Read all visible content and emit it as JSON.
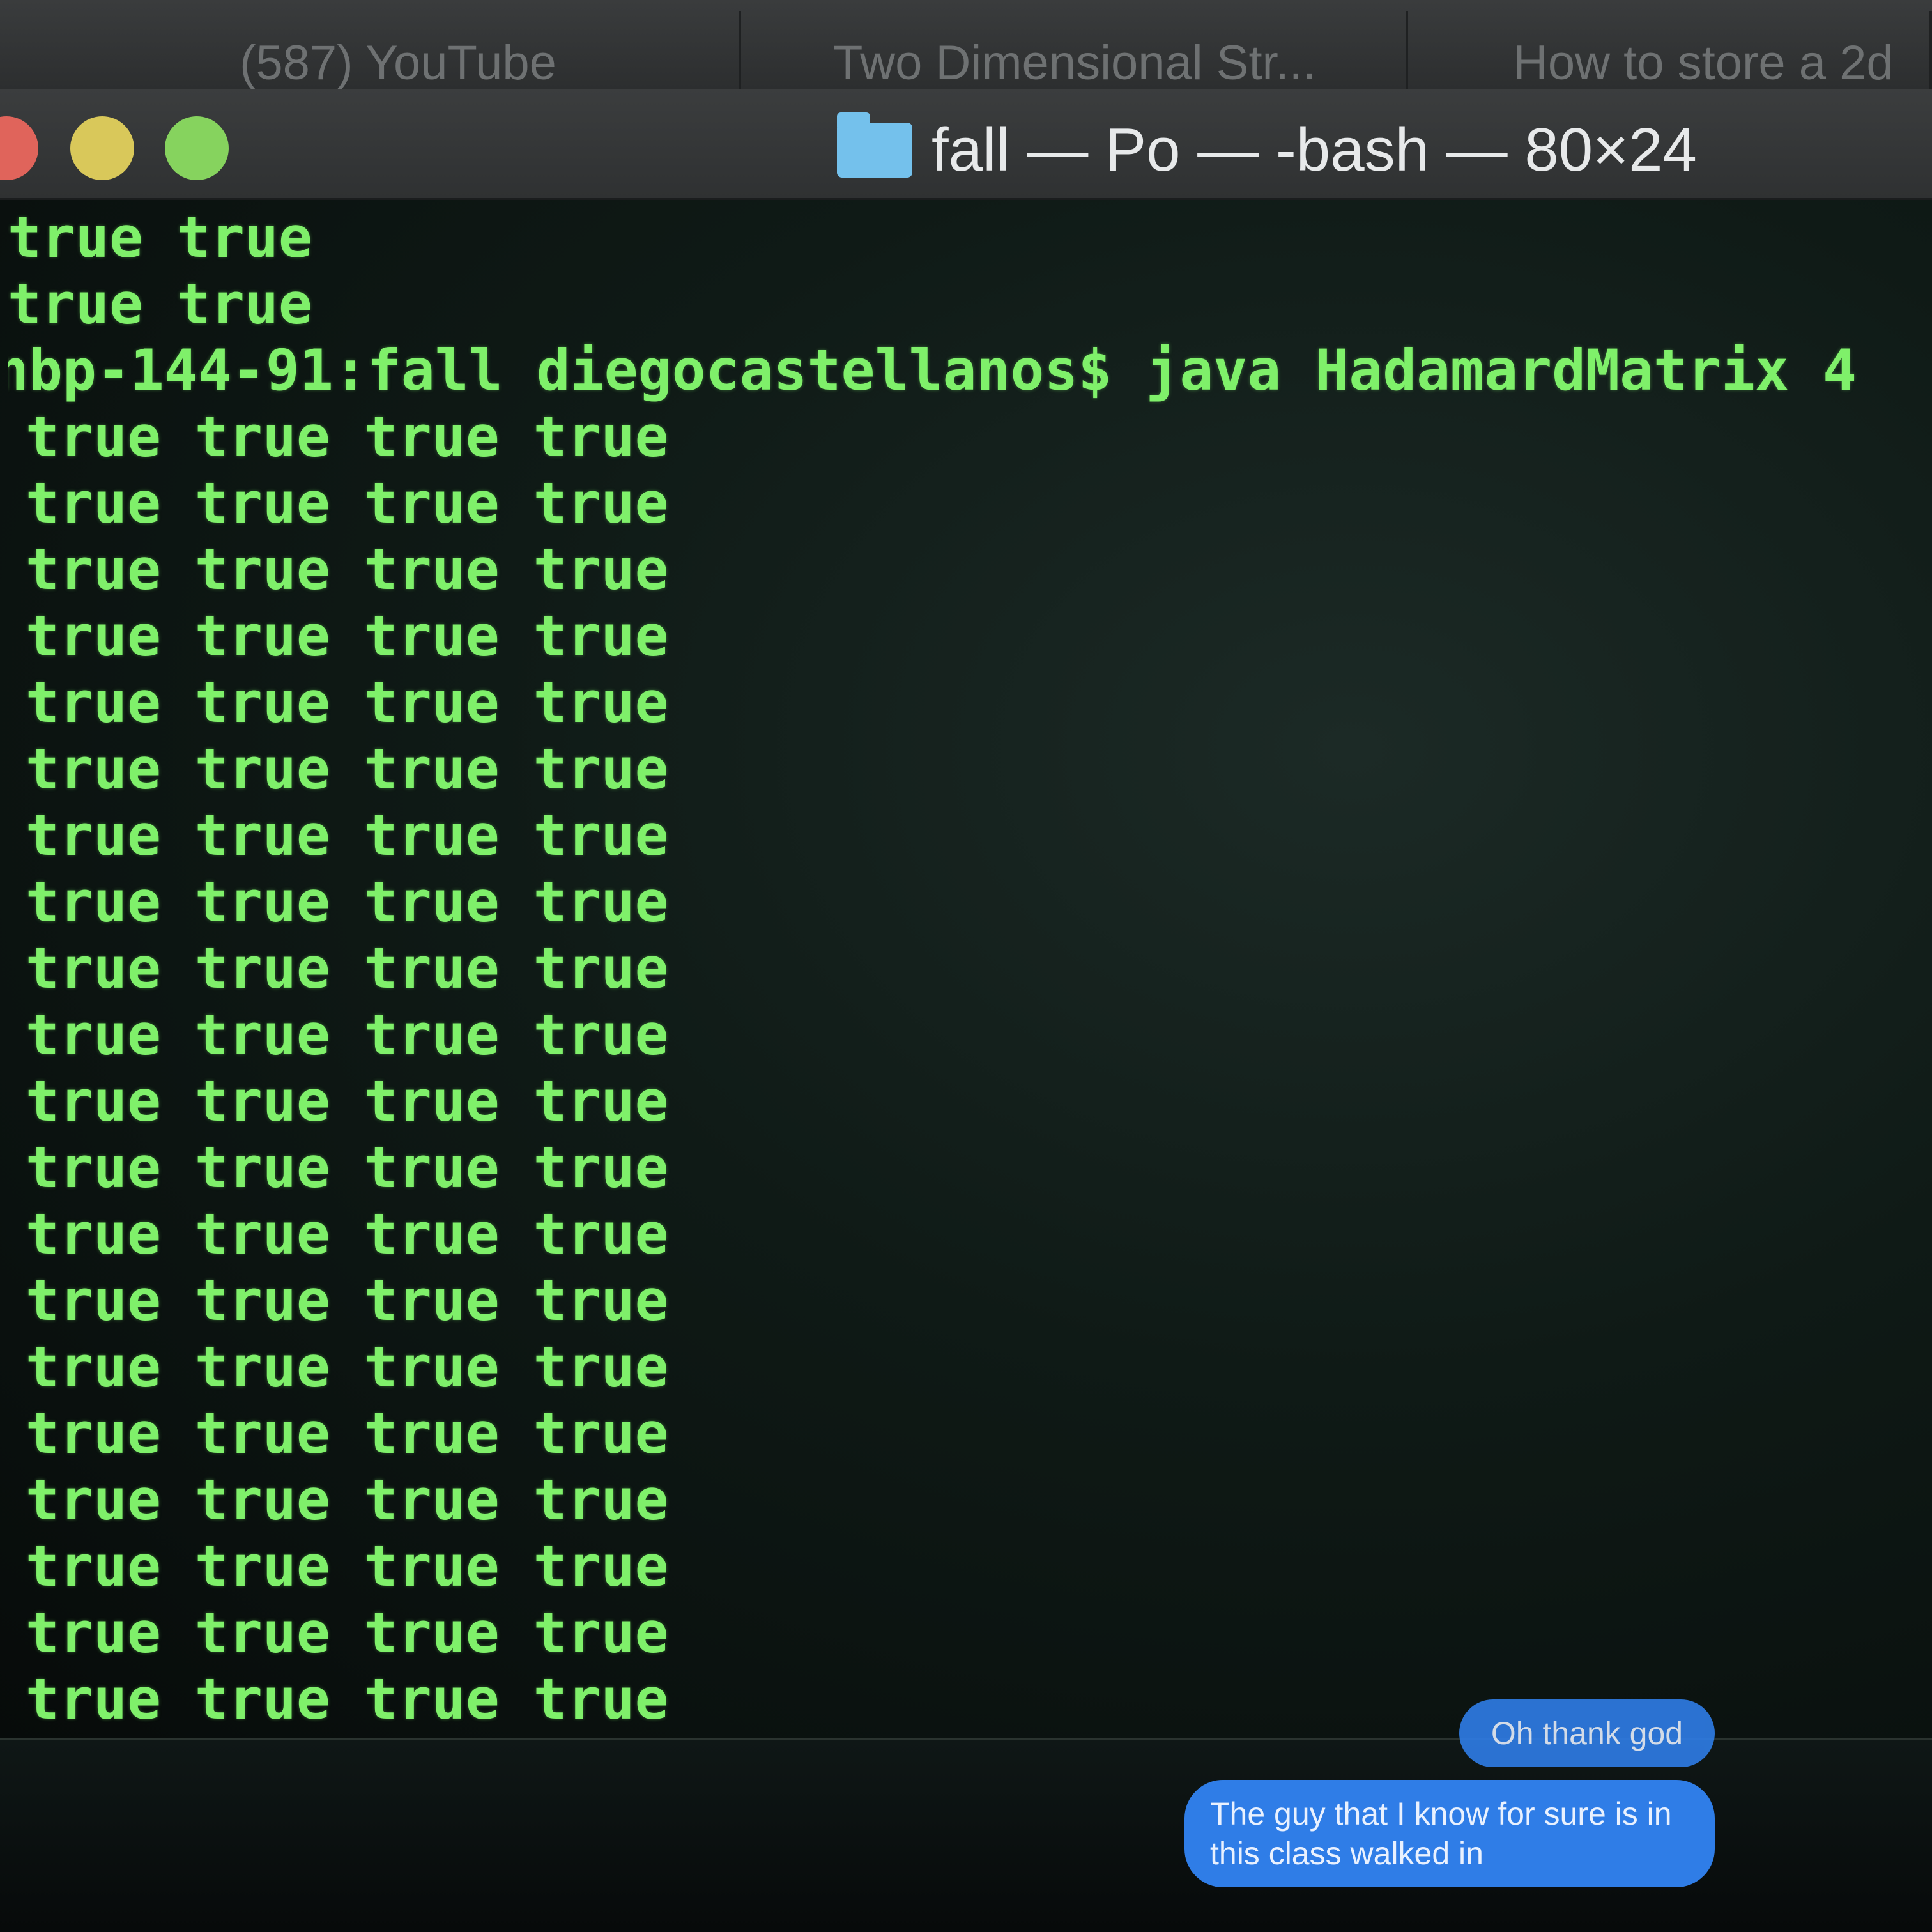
{
  "browser_tabs": [
    {
      "label": "(587) YouTube"
    },
    {
      "label": "Two Dimensional Str..."
    },
    {
      "label": "How to store a 2d"
    }
  ],
  "terminal": {
    "title": "fall — Po — -bash — 80×24",
    "prev_output": [
      "true true",
      "true true"
    ],
    "prompt": "nbp-144-91:fall diegocastellanos$ java HadamardMatrix 4",
    "row_text": "true true true true",
    "row_count": 21
  },
  "messages": [
    {
      "text": "Oh thank god"
    },
    {
      "text": "The guy that I know for sure is in this class walked in"
    }
  ]
}
